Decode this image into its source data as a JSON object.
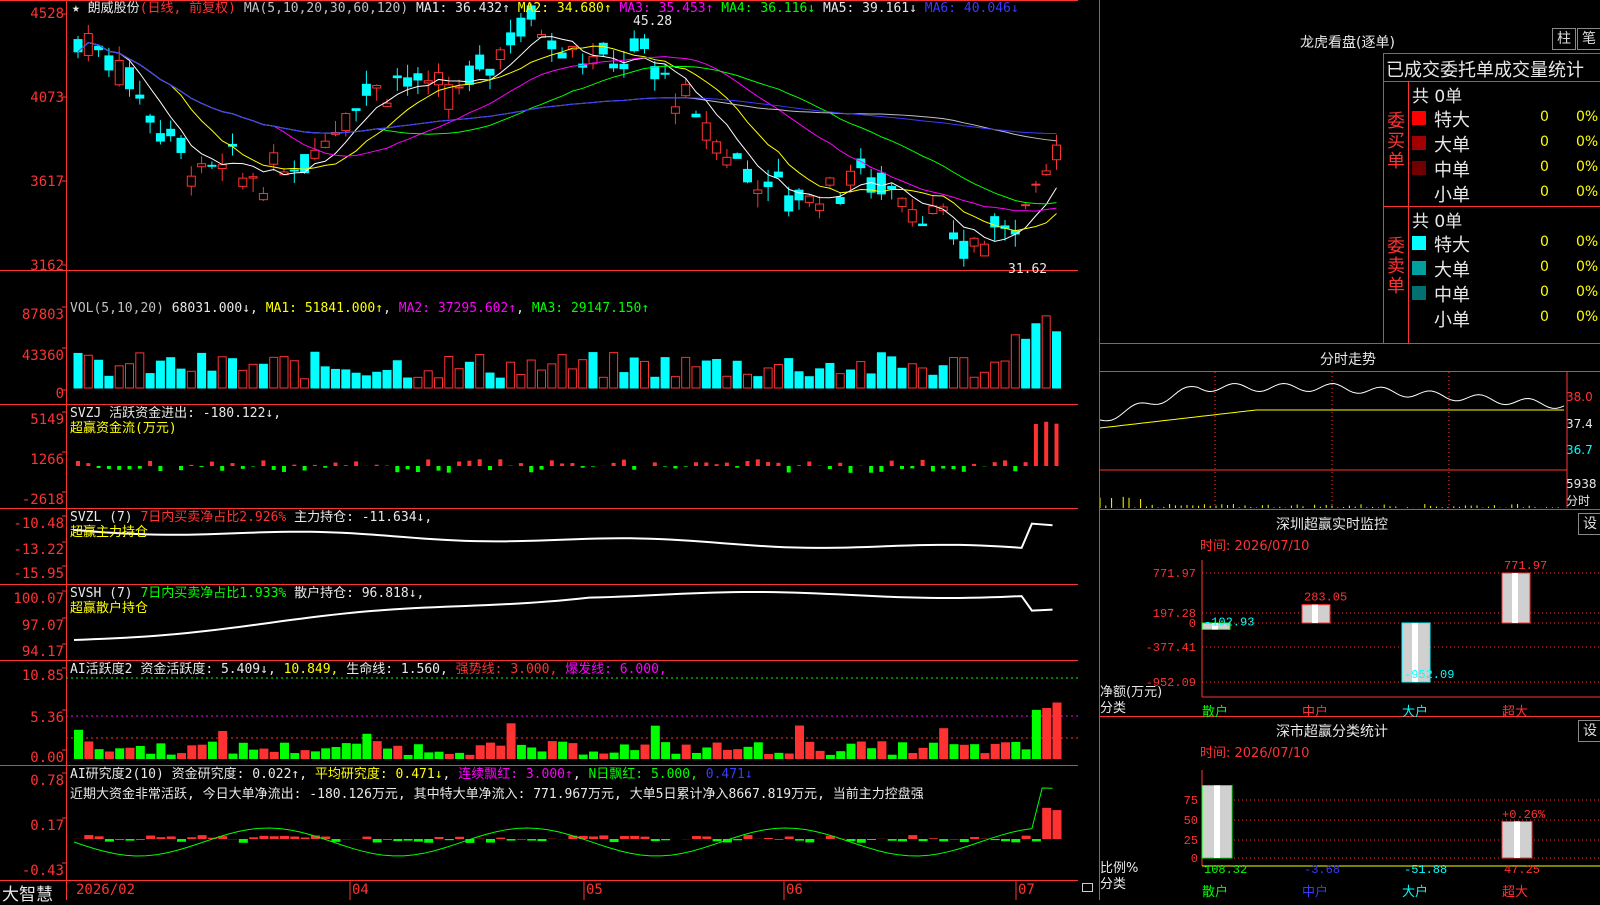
{
  "chart_header": {
    "title": "朗威股份",
    "period": "(日线, 前复权)",
    "ma_label": "MA(5,10,20,30,60,120)",
    "ma1": "MA1: 36.432↑",
    "ma2": "MA2: 34.680↑",
    "ma3": "MA3: 35.453↑",
    "ma4": "MA4: 36.116↓",
    "ma5": "MA5: 39.161↓",
    "ma6": "MA6: 40.046↓"
  },
  "price_axis": [
    "4528",
    "4073",
    "3617",
    "3162"
  ],
  "annotations": {
    "high": "45.28",
    "low": "31.62"
  },
  "vol": {
    "label": "VOL(5,10,20)",
    "value": "68031.000↓",
    "ma1": "MA1: 51841.000↑",
    "ma2": "MA2: 37295.602↑",
    "ma3": "MA3: 29147.150↑",
    "axis": [
      "87803",
      "43360",
      "0"
    ]
  },
  "svzj": {
    "label": "SVZJ",
    "desc": "活跃资金进出: -180.122↓,",
    "sub": "超赢资金流(万元)",
    "axis": [
      "5149",
      "1266",
      "-2618"
    ]
  },
  "svzl": {
    "label": "SVZL (7)",
    "ratio": "7日内买卖净占比2.926%",
    "hold": "主力持仓: -11.634↓,",
    "sub": "超赢主力持仓",
    "axis": [
      "-10.48",
      "-13.22",
      "-15.95"
    ]
  },
  "svsh": {
    "label": "SVSH (7)",
    "ratio": "7日内买卖净占比1.933%",
    "hold": "散户持仓: 96.818↓,",
    "sub": "超赢散户持仓",
    "axis": [
      "100.07",
      "97.07",
      "94.17"
    ]
  },
  "ai1": {
    "label": "AI活跃度2",
    "a": "资金活跃度: 5.409↓",
    "b": "10.849,",
    "c": "生命线: 1.560,",
    "d": "强势线: 3.000,",
    "e": "爆发线: 6.000,",
    "axis": [
      "10.85",
      "5.36",
      "0.00"
    ]
  },
  "ai2": {
    "label": "AI研究度2(10)",
    "a": "资金研究度: 0.022↑",
    "b": "平均研究度: 0.471↓",
    "c": "连续飘红: 3.000↑",
    "d": "N日飘红: 5.000,",
    "e": "0.471↓",
    "text": "近期大资金非常活跃, 今日大单净流出: -180.126万元, 其中特大单净流入: 771.967万元, 大单5日累计净入8667.819万元, 当前主力控盘强",
    "axis": [
      "0.78",
      "0.17",
      "-0.43"
    ]
  },
  "xaxis": {
    "logo": "大智慧",
    "labels": [
      "2026/02",
      "04",
      "05",
      "06",
      "07"
    ]
  },
  "panel": {
    "title": "龙虎看盘(逐单)",
    "btn1": "柱",
    "btn2": "笔",
    "subtitle": "已成交委托单成交量统计",
    "buy": {
      "group": "委买单",
      "total": "共 0单",
      "rows": [
        {
          "name": "特大",
          "qty": "0",
          "pct": "0%",
          "color": "#ff0000"
        },
        {
          "name": "大单",
          "qty": "0",
          "pct": "0%",
          "color": "#a00000"
        },
        {
          "name": "中单",
          "qty": "0",
          "pct": "0%",
          "color": "#700000"
        },
        {
          "name": "小单",
          "qty": "0",
          "pct": "0%",
          "color": "#000000"
        }
      ]
    },
    "sell": {
      "group": "委卖单",
      "total": "共 0单",
      "rows": [
        {
          "name": "特大",
          "qty": "0",
          "pct": "0%",
          "color": "#00ffff"
        },
        {
          "name": "大单",
          "qty": "0",
          "pct": "0%",
          "color": "#00a0a0"
        },
        {
          "name": "中单",
          "qty": "0",
          "pct": "0%",
          "color": "#007070"
        },
        {
          "name": "小单",
          "qty": "0",
          "pct": "0%",
          "color": "#000000"
        }
      ]
    }
  },
  "intraday": {
    "title": "分时走势",
    "axis": [
      "38.0",
      "37.4",
      "36.7",
      "5938",
      "分时"
    ]
  },
  "monitor": {
    "title": "深圳超赢实时监控",
    "btn": "设",
    "time": "时间: 2026/07/10",
    "ylab": "净额(万元)",
    "xlab": "分类",
    "axis": [
      "771.97",
      "197.28",
      "0",
      "-377.41",
      "-952.09"
    ],
    "chart_data": {
      "type": "bar",
      "categories": [
        "散户",
        "中户",
        "大户",
        "超大"
      ],
      "values": [
        -102.93,
        283.05,
        -952.09,
        771.97
      ],
      "labels": [
        "-102.93",
        "283.05",
        "-952.09",
        "771.97"
      ],
      "ylim": [
        -952.09,
        771.97
      ]
    }
  },
  "classify": {
    "title": "深市超赢分类统计",
    "btn": "设",
    "time": "时间: 2026/07/10",
    "ylab": "比例%",
    "xlab": "分类",
    "axis": [
      "75",
      "50",
      "25",
      "0"
    ],
    "top_label": "+0.26%",
    "chart_data": {
      "type": "bar",
      "categories": [
        "散户",
        "中户",
        "大户",
        "超大"
      ],
      "values": [
        108.32,
        -3.68,
        -51.88,
        47.25
      ],
      "labels": [
        "108.32",
        "-3.68",
        "-51.88",
        "47.25"
      ],
      "ylim": [
        0,
        75
      ]
    }
  }
}
